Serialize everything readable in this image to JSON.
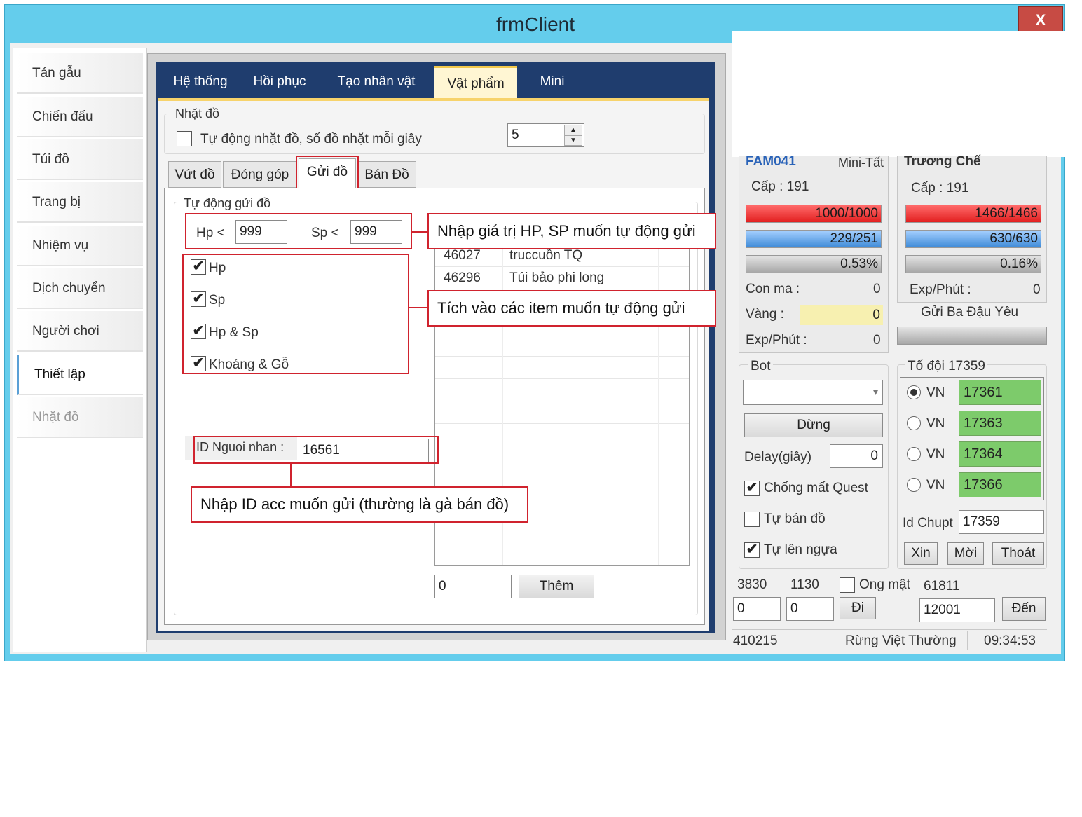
{
  "window": {
    "title": "frmClient",
    "close_label": "X"
  },
  "nav": [
    {
      "label": "Tán gẫu",
      "state": "normal"
    },
    {
      "label": "Chiến đấu",
      "state": "normal"
    },
    {
      "label": "Túi đồ",
      "state": "normal"
    },
    {
      "label": "Trang bị",
      "state": "normal"
    },
    {
      "label": "Nhiệm vụ",
      "state": "normal"
    },
    {
      "label": "Dịch chuyển",
      "state": "normal"
    },
    {
      "label": "Người chơi",
      "state": "normal"
    },
    {
      "label": "Thiết lập",
      "state": "active"
    },
    {
      "label": "Nhặt đồ",
      "state": "disabled"
    }
  ],
  "tabs": [
    "Hệ thống",
    "Hồi phục",
    "Tạo nhân vật",
    "Vật phẩm",
    "Mini"
  ],
  "pickup": {
    "legend": "Nhặt đồ",
    "checkbox_label": "Tự động nhặt đồ, số đồ nhặt mỗi giây",
    "checked": false,
    "value": "5"
  },
  "subtabs": [
    "Vứt đồ",
    "Đóng góp",
    "Gửi đồ",
    "Bán Đồ"
  ],
  "send": {
    "legend": "Tự động gửi đồ",
    "hp_label": "Hp <",
    "hp_value": "999",
    "sp_label": "Sp <",
    "sp_value": "999",
    "items": [
      {
        "label": "Hp",
        "checked": true
      },
      {
        "label": "Sp",
        "checked": true
      },
      {
        "label": "Hp & Sp",
        "checked": true
      },
      {
        "label": "Khoáng & Gỗ",
        "checked": true
      }
    ],
    "receiver_label": "ID Nguoi nhan :",
    "receiver_value": "16561",
    "list": [
      {
        "id": "46027",
        "name": "truccuồn TQ"
      },
      {
        "id": "46296",
        "name": "Túi bảo phi long"
      }
    ],
    "add_value": "0",
    "add_label": "Thêm"
  },
  "callouts": {
    "hp_sp": "Nhập giá trị HP, SP muốn tự động gửi",
    "items": "Tích vào các item muốn tự động gửi",
    "receiver": "Nhập ID acc muốn gửi (thường là gà bán đồ)"
  },
  "char1": {
    "name": "FAM041",
    "tag": "Mini-Tất",
    "level": "Cấp : 191",
    "hp": "1000/1000",
    "sp": "229/251",
    "exp": "0.53%",
    "rows": [
      {
        "label": "Con ma :",
        "value": "0"
      },
      {
        "label": "Vàng :",
        "value": "0"
      },
      {
        "label": "Exp/Phút :",
        "value": "0"
      }
    ]
  },
  "char2": {
    "name": "Trương Chế",
    "level": "Cấp : 191",
    "hp": "1466/1466",
    "sp": "630/630",
    "exp": "0.16%",
    "exp_label": "Exp/Phút :",
    "exp_value": "0",
    "gift_label": "Gửi Ba Đậu Yêu"
  },
  "bot": {
    "legend": "Bot",
    "select_value": "",
    "stop_label": "Dừng",
    "delay_label": "Delay(giây)",
    "delay_value": "0",
    "options": [
      {
        "label": "Chống mất Quest",
        "checked": true
      },
      {
        "label": "Tự bán đồ",
        "checked": false
      },
      {
        "label": "Tự lên ngựa",
        "checked": true
      }
    ]
  },
  "team": {
    "legend": "Tổ đội  17359",
    "members": [
      {
        "label": "VN",
        "value": "17361",
        "selected": true
      },
      {
        "label": "VN",
        "value": "17363",
        "selected": false
      },
      {
        "label": "VN",
        "value": "17364",
        "selected": false
      },
      {
        "label": "VN",
        "value": "17366",
        "selected": false
      }
    ],
    "idchupt_label": "Id Chupt",
    "idchupt_value": "17359",
    "buttons": [
      "Xin",
      "Mời",
      "Thoát"
    ]
  },
  "coords": {
    "x": "3830",
    "y": "1130",
    "ong_mat_label": "Ong mật",
    "ong_mat_value": "61811",
    "input1": "0",
    "input2": "0",
    "go_label": "Đi",
    "dest_value": "12001",
    "dest_label": "Đến"
  },
  "status": {
    "id": "410215",
    "map": "Rừng Việt Thường",
    "time": "09:34:53"
  }
}
